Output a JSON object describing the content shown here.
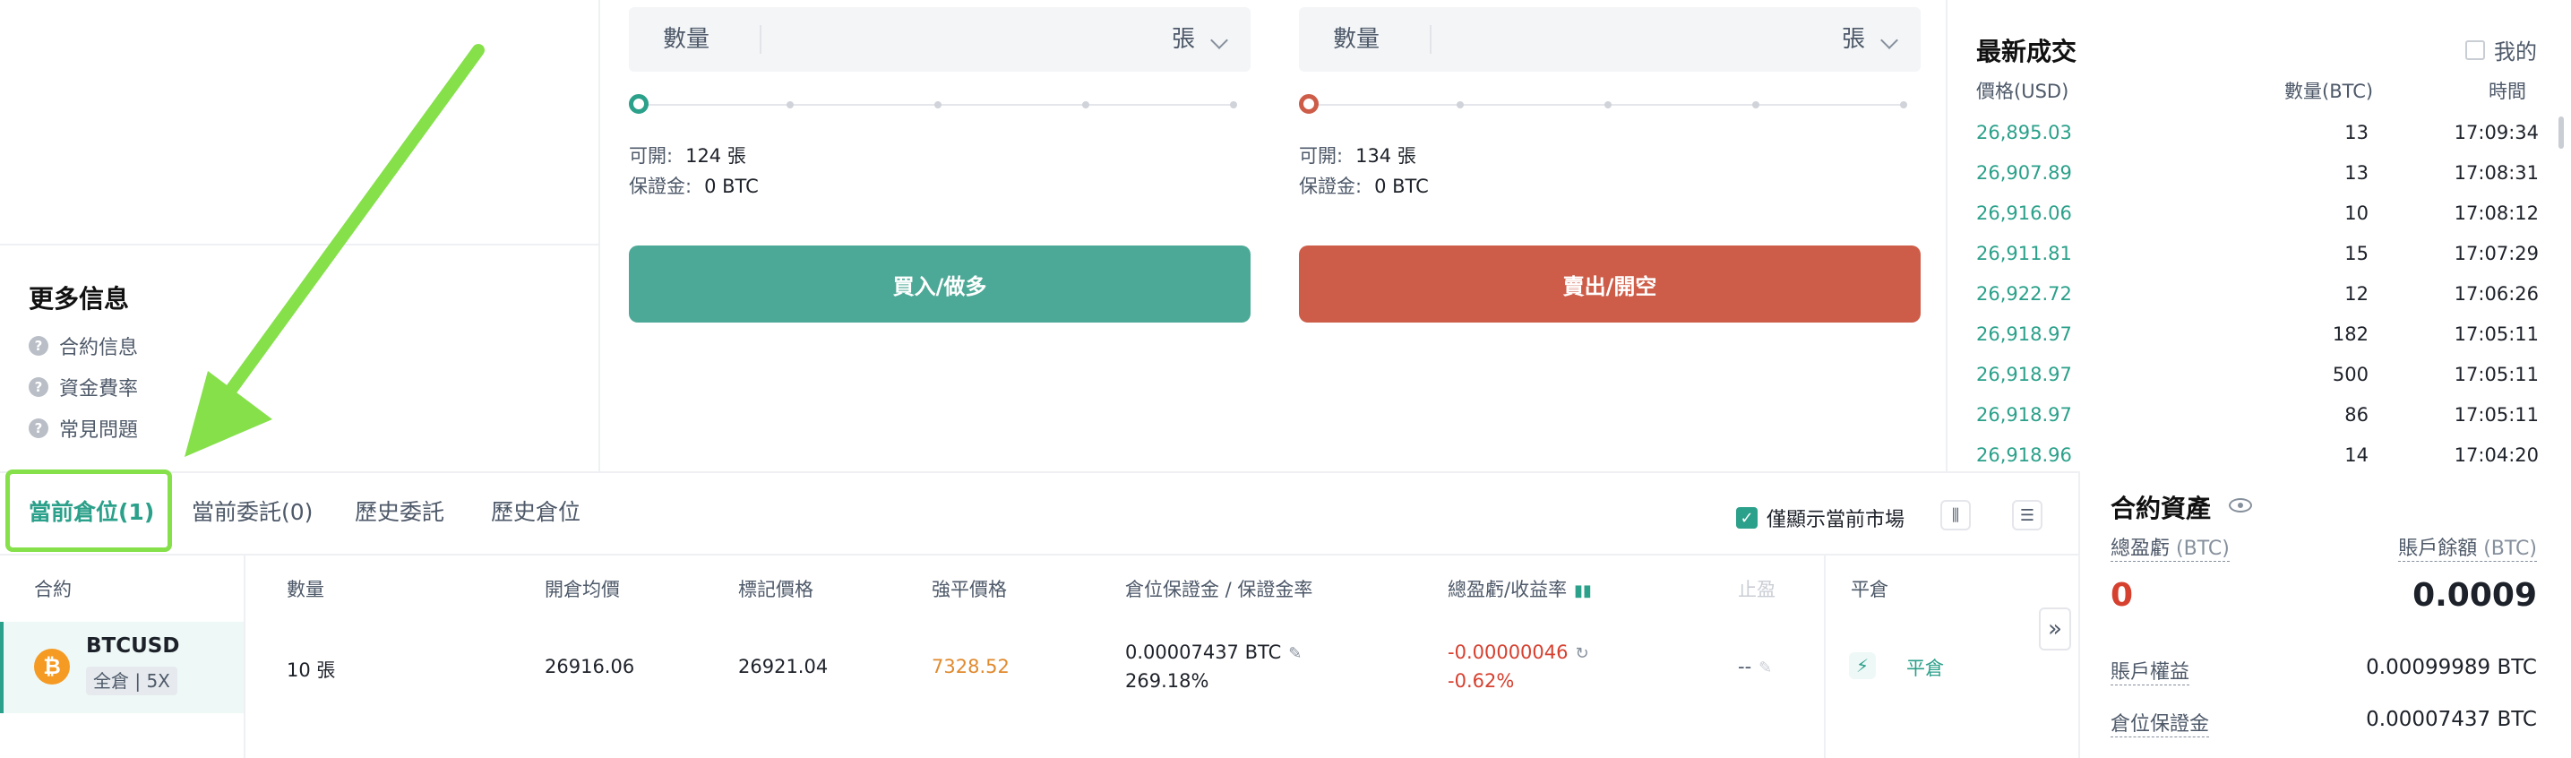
{
  "left": {
    "more_title": "更多信息",
    "links": [
      "合約信息",
      "資金費率",
      "常見問題"
    ]
  },
  "order_form": {
    "buy": {
      "qty_label": "數量",
      "unit": "張",
      "available_label": "可開:",
      "available_value": "124 張",
      "margin_label": "保證金:",
      "margin_value": "0 BTC",
      "button": "買入/做多",
      "color": "#4da997"
    },
    "sell": {
      "qty_label": "數量",
      "unit": "張",
      "available_label": "可開:",
      "available_value": "134 張",
      "margin_label": "保證金:",
      "margin_value": "0 BTC",
      "button": "賣出/開空",
      "color": "#cd5c48"
    }
  },
  "trades": {
    "title": "最新成交",
    "mine_label": "我的",
    "headers": {
      "price": "價格(USD)",
      "qty": "數量(BTC)",
      "time": "時間"
    },
    "rows": [
      {
        "price": "26,895.03",
        "qty": "13",
        "time": "17:09:34"
      },
      {
        "price": "26,907.89",
        "qty": "13",
        "time": "17:08:31"
      },
      {
        "price": "26,916.06",
        "qty": "10",
        "time": "17:08:12"
      },
      {
        "price": "26,911.81",
        "qty": "15",
        "time": "17:07:29"
      },
      {
        "price": "26,922.72",
        "qty": "12",
        "time": "17:06:26"
      },
      {
        "price": "26,918.97",
        "qty": "182",
        "time": "17:05:11"
      },
      {
        "price": "26,918.97",
        "qty": "500",
        "time": "17:05:11"
      },
      {
        "price": "26,918.97",
        "qty": "86",
        "time": "17:05:11"
      },
      {
        "price": "26,918.96",
        "qty": "14",
        "time": "17:04:20"
      }
    ],
    "price_color": "#2ba08a"
  },
  "positions": {
    "tabs": [
      "當前倉位(1)",
      "當前委託(0)",
      "歷史委託",
      "歷史倉位"
    ],
    "only_current_market": "僅顯示當前市場",
    "columns": {
      "contract": "合約",
      "qty": "數量",
      "avg_open": "開倉均價",
      "mark": "標記價格",
      "liq": "強平價格",
      "margin": "倉位保證金 / 保證金率",
      "pnl": "總盈虧/收益率",
      "stop": "止盈",
      "close": "平倉"
    },
    "row": {
      "symbol": "BTCUSD",
      "mode": "全倉 | 5X",
      "coin_glyph": "₿",
      "qty": "10 張",
      "avg_open": "26916.06",
      "mark": "26921.04",
      "liq": "7328.52",
      "margin": "0.00007437 BTC",
      "margin_rate": "269.18%",
      "pnl": "-0.00000046",
      "pnl_rate": "-0.62%",
      "stop": "--",
      "close": "平倉"
    }
  },
  "assets": {
    "title": "合約資產",
    "pnl_label": "總盈虧",
    "pnl_unit": "(BTC)",
    "pnl_value": "0",
    "balance_label": "賬戶餘額",
    "balance_unit": "(BTC)",
    "balance_value": "0.0009",
    "equity_label": "賬戶權益",
    "equity_value": "0.00099989 BTC",
    "margin_label": "倉位保證金",
    "margin_value": "0.00007437 BTC"
  },
  "annotation": {
    "arrow_color": "#85e04a"
  }
}
